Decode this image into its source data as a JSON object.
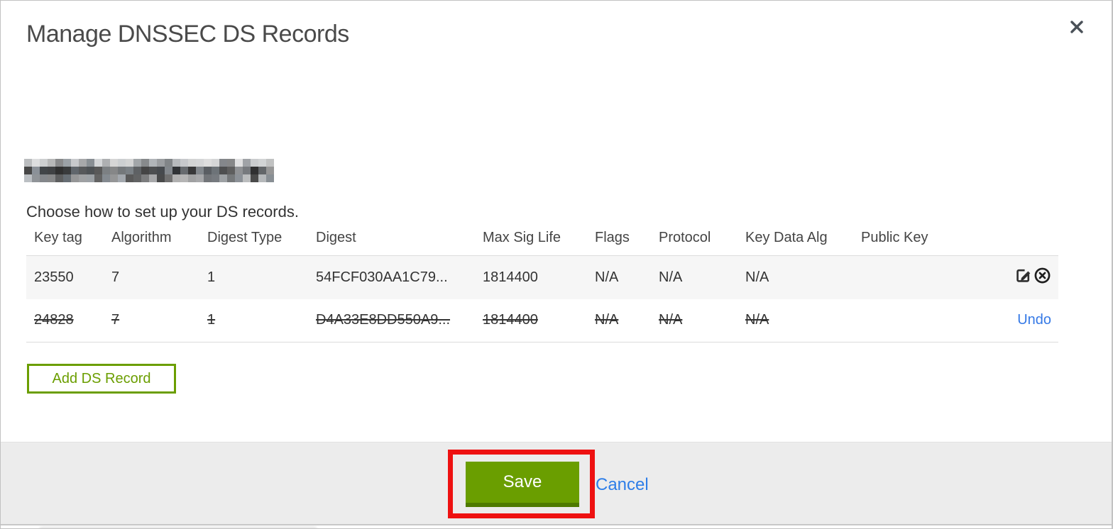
{
  "dialog": {
    "title": "Manage DNSSEC DS Records",
    "subtitle": "Choose how to set up your DS records."
  },
  "table": {
    "columns": [
      "Key tag",
      "Algorithm",
      "Digest Type",
      "Digest",
      "Max Sig Life",
      "Flags",
      "Protocol",
      "Key Data Alg",
      "Public Key"
    ],
    "rows": [
      {
        "key_tag": "23550",
        "algorithm": "7",
        "digest_type": "1",
        "digest": "54FCF030AA1C79...",
        "max_sig_life": "1814400",
        "flags": "N/A",
        "protocol": "N/A",
        "key_data_alg": "N/A",
        "public_key": "",
        "state": "active"
      },
      {
        "key_tag": "24828",
        "algorithm": "7",
        "digest_type": "1",
        "digest": "D4A33E8DD550A9...",
        "max_sig_life": "1814400",
        "flags": "N/A",
        "protocol": "N/A",
        "key_data_alg": "N/A",
        "public_key": "",
        "state": "deleted",
        "undo_label": "Undo"
      }
    ]
  },
  "buttons": {
    "add_ds_record": "Add DS Record",
    "save": "Save",
    "cancel": "Cancel"
  },
  "colors": {
    "accent_green": "#6a9e00",
    "accent_green_dark": "#4e7a00",
    "link_blue": "#2e7ee8",
    "annotation_red": "#ee1111",
    "row_highlight": "#f6f6f6",
    "footer_gray": "#ececec"
  }
}
